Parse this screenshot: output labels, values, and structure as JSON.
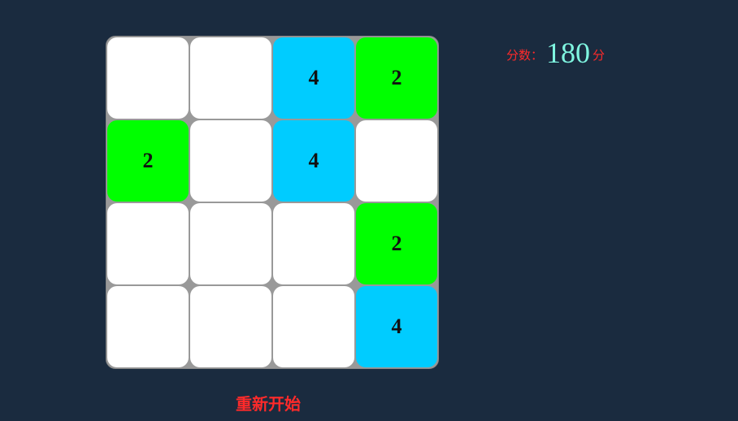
{
  "score": {
    "label": "分数：",
    "value": "180",
    "unit": "分"
  },
  "restart_label": "重新开始",
  "colors": {
    "empty": "#ffffff",
    "2": "#00ff00",
    "4": "#00ccff"
  },
  "grid": [
    [
      "",
      "",
      "4",
      "2"
    ],
    [
      "2",
      "",
      "4",
      ""
    ],
    [
      "",
      "",
      "",
      "2"
    ],
    [
      "",
      "",
      "",
      "4"
    ]
  ]
}
